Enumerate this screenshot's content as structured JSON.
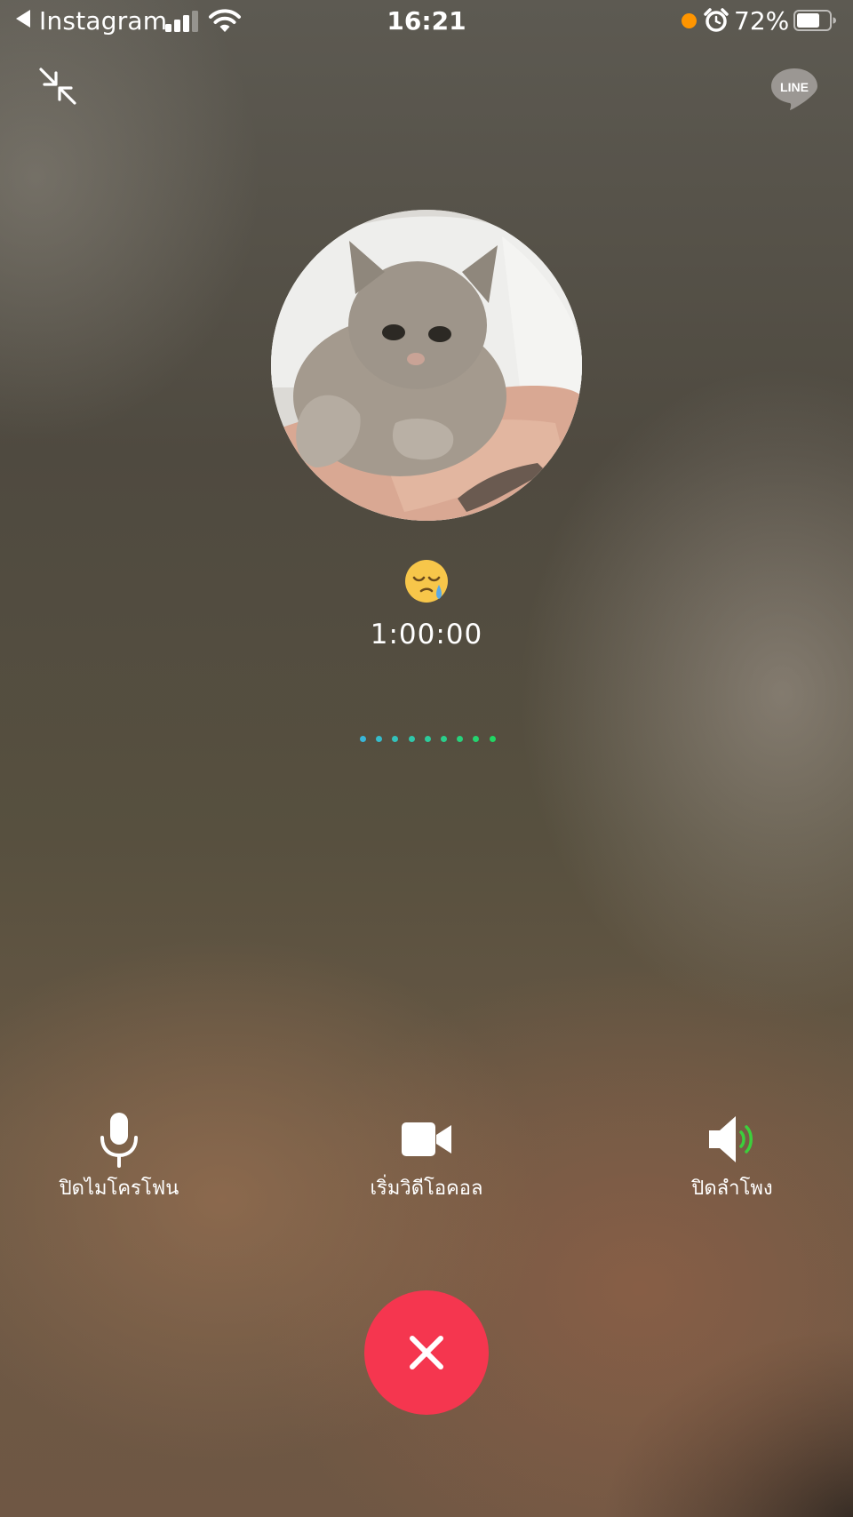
{
  "status_bar": {
    "back_app": "Instagram",
    "time": "16:21",
    "battery_percent": "72%",
    "signal_bars_active": 3,
    "battery_level": 0.72,
    "icons": [
      "back-arrow-icon",
      "cellular-signal-icon",
      "wifi-icon",
      "recording-indicator-icon",
      "alarm-icon",
      "battery-icon"
    ]
  },
  "header": {
    "minimize_icon": "minimize-arrows-icon",
    "logo_text": "LINE"
  },
  "call": {
    "status_emoji": "😪",
    "timer": "1:00:00",
    "connecting_dots": 9,
    "dot_colors": [
      "#39b6d9",
      "#36bccb",
      "#33c2bb",
      "#30c7ab",
      "#2dcb9b",
      "#2acf8b",
      "#27d27c",
      "#24d46f",
      "#21d663"
    ]
  },
  "controls": {
    "mute": {
      "label": "ปิดไมโครโฟน",
      "icon": "microphone-icon"
    },
    "video": {
      "label": "เริ่มวิดีโอคอล",
      "icon": "video-camera-icon"
    },
    "speaker": {
      "label": "ปิดลำโพง",
      "icon": "speaker-icon"
    },
    "end_call": {
      "icon": "close-icon",
      "color": "#f5364f"
    }
  },
  "colors": {
    "speaker_wave": "#3ccf3c",
    "end_call": "#f5364f",
    "recording_dot": "#ff9500"
  }
}
